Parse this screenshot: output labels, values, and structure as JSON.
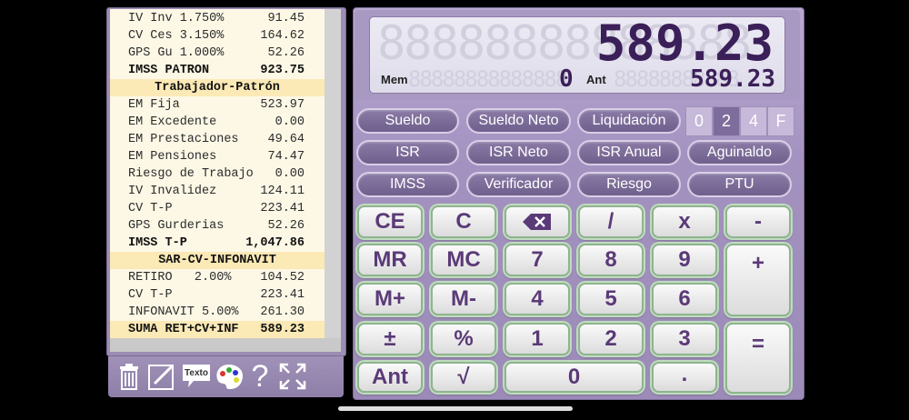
{
  "tape": {
    "rows": [
      {
        "label": "IV Inv 1.750%",
        "value": "91.45",
        "style": ""
      },
      {
        "label": "CV Ces 3.150%",
        "value": "164.62",
        "style": ""
      },
      {
        "label": "GPS Gu 1.000%",
        "value": "52.26",
        "style": ""
      },
      {
        "label": "IMSS PATRON",
        "value": "923.75",
        "style": "bold"
      },
      {
        "label": "Trabajador-Patrón",
        "value": "",
        "style": "section"
      },
      {
        "label": "EM Fija",
        "value": "523.97",
        "style": ""
      },
      {
        "label": "EM Excedente",
        "value": "0.00",
        "style": ""
      },
      {
        "label": "EM Prestaciones",
        "value": "49.64",
        "style": ""
      },
      {
        "label": "EM Pensiones",
        "value": "74.47",
        "style": ""
      },
      {
        "label": "Riesgo de Trabajo",
        "value": "0.00",
        "style": ""
      },
      {
        "label": "IV Invalidez",
        "value": "124.11",
        "style": ""
      },
      {
        "label": "CV T-P",
        "value": "223.41",
        "style": ""
      },
      {
        "label": "GPS Gurderias",
        "value": "52.26",
        "style": ""
      },
      {
        "label": "IMSS T-P",
        "value": "1,047.86",
        "style": "bold"
      },
      {
        "label": "SAR-CV-INFONAVIT",
        "value": "",
        "style": "section"
      },
      {
        "label": "RETIRO   2.00%",
        "value": "104.52",
        "style": ""
      },
      {
        "label": "CV T-P",
        "value": "223.41",
        "style": ""
      },
      {
        "label": "INFONAVIT 5.00%",
        "value": "261.30",
        "style": ""
      },
      {
        "label": "SUMA RET+CV+INF",
        "value": "589.23",
        "style": "boldhl"
      }
    ],
    "tools": {
      "trash": "trash-icon",
      "edit": "edit-icon",
      "text_label": "Texto",
      "palette": "palette-icon",
      "help": "?",
      "expand": "expand-icon"
    }
  },
  "display": {
    "main_value": "589.23",
    "main_ghost": "88888888888888",
    "mem_label": "Mem",
    "mem_value": "0",
    "mem_ghost": "88888888888888",
    "ant_label": "Ant",
    "ant_value": "589.23",
    "ant_ghost": "88888888888"
  },
  "functions": {
    "row1": [
      "Sueldo",
      "Sueldo Neto",
      "Liquidación"
    ],
    "row2": [
      "ISR",
      "ISR Neto",
      "ISR Anual",
      "Aguinaldo"
    ],
    "row3": [
      "IMSS",
      "Verificador",
      "Riesgo",
      "PTU"
    ]
  },
  "decimals": {
    "options": [
      "0",
      "2",
      "4",
      "F"
    ],
    "selected": "2"
  },
  "keys": {
    "ce": "CE",
    "c": "C",
    "div": "/",
    "mul": "x",
    "minus": "-",
    "mr": "MR",
    "mc": "MC",
    "k7": "7",
    "k8": "8",
    "k9": "9",
    "plus": "+",
    "mplus": "M+",
    "mminus": "M-",
    "k4": "4",
    "k5": "5",
    "k6": "6",
    "pm": "±",
    "pct": "%",
    "k1": "1",
    "k2": "2",
    "k3": "3",
    "eq": "=",
    "ant": "Ant",
    "sqrt": "√",
    "k0": "0",
    "dot": "."
  },
  "colors": {
    "accent": "#5b3a78",
    "panel": "#a392c0",
    "tape_highlight": "#fbe9b6"
  }
}
